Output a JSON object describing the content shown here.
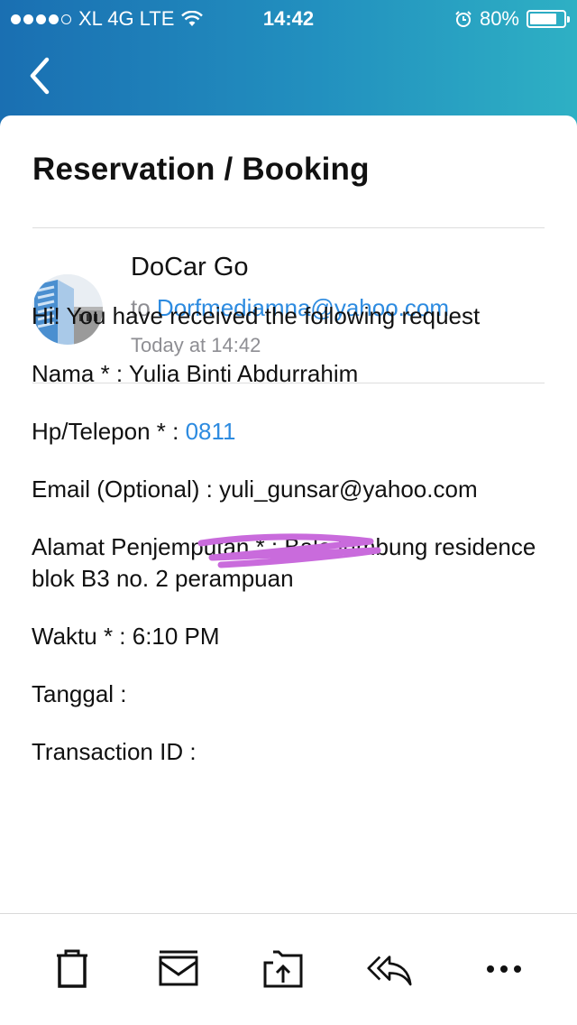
{
  "status_bar": {
    "carrier": "XL 4G LTE",
    "time": "14:42",
    "battery": "80%",
    "battery_level": 0.8
  },
  "email": {
    "subject": "Reservation / Booking",
    "sender_name": "DoCar Go",
    "to_prefix": "to",
    "recipient": "Dorfmediamna@yahoo.com",
    "timestamp": "Today at 14:42"
  },
  "body": {
    "greeting": "Hi! You have received the following request",
    "nama": "Nama * : Yulia Binti Abdurrahim",
    "hp_label": "Hp/Telepon * : ",
    "hp_value": "0811",
    "email_optional": "Email (Optional) : yuli_gunsar@yahoo.com",
    "alamat": "Alamat Penjemputan * : Bale lumbung residence blok B3 no. 2 perampuan",
    "waktu": "Waktu * : 6:10 PM",
    "tanggal": "Tanggal :",
    "transaction_id": "Transaction ID :"
  },
  "toolbar": {
    "icons": [
      "trash-icon",
      "archive-icon",
      "move-icon",
      "reply-all-icon",
      "more-icon"
    ]
  },
  "colors": {
    "header_gradient_start": "#1a6fb2",
    "header_gradient_end": "#2eb0c4",
    "link": "#2d8be0",
    "redaction": "#c96bdc"
  }
}
